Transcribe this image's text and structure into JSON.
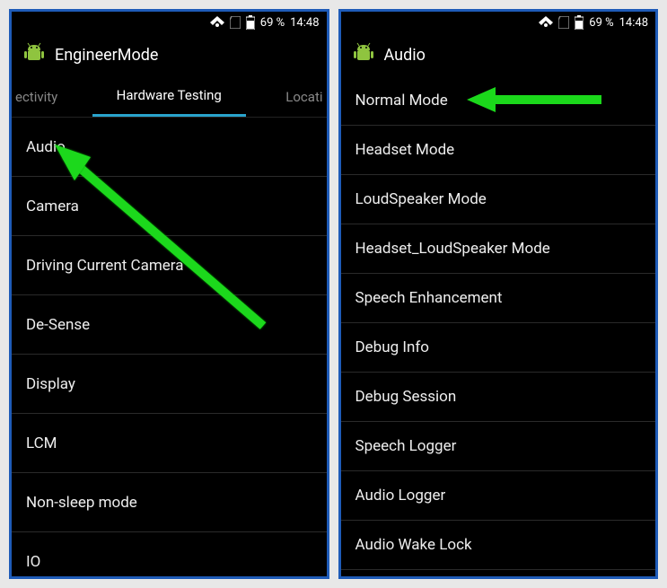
{
  "status": {
    "battery": "69 %",
    "time": "14:48"
  },
  "left": {
    "title": "EngineerMode",
    "tabs": {
      "prev": "ectivity",
      "active": "Hardware Testing",
      "next": "Locati"
    },
    "items": [
      "Audio",
      "Camera",
      "Driving Current Camera",
      "De-Sense",
      "Display",
      "LCM",
      "Non-sleep mode",
      "IO"
    ]
  },
  "right": {
    "title": "Audio",
    "items": [
      "Normal Mode",
      "Headset Mode",
      "LoudSpeaker Mode",
      "Headset_LoudSpeaker Mode",
      "Speech Enhancement",
      "Debug Info",
      "Debug Session",
      "Speech Logger",
      "Audio Logger",
      "Audio Wake Lock"
    ]
  }
}
